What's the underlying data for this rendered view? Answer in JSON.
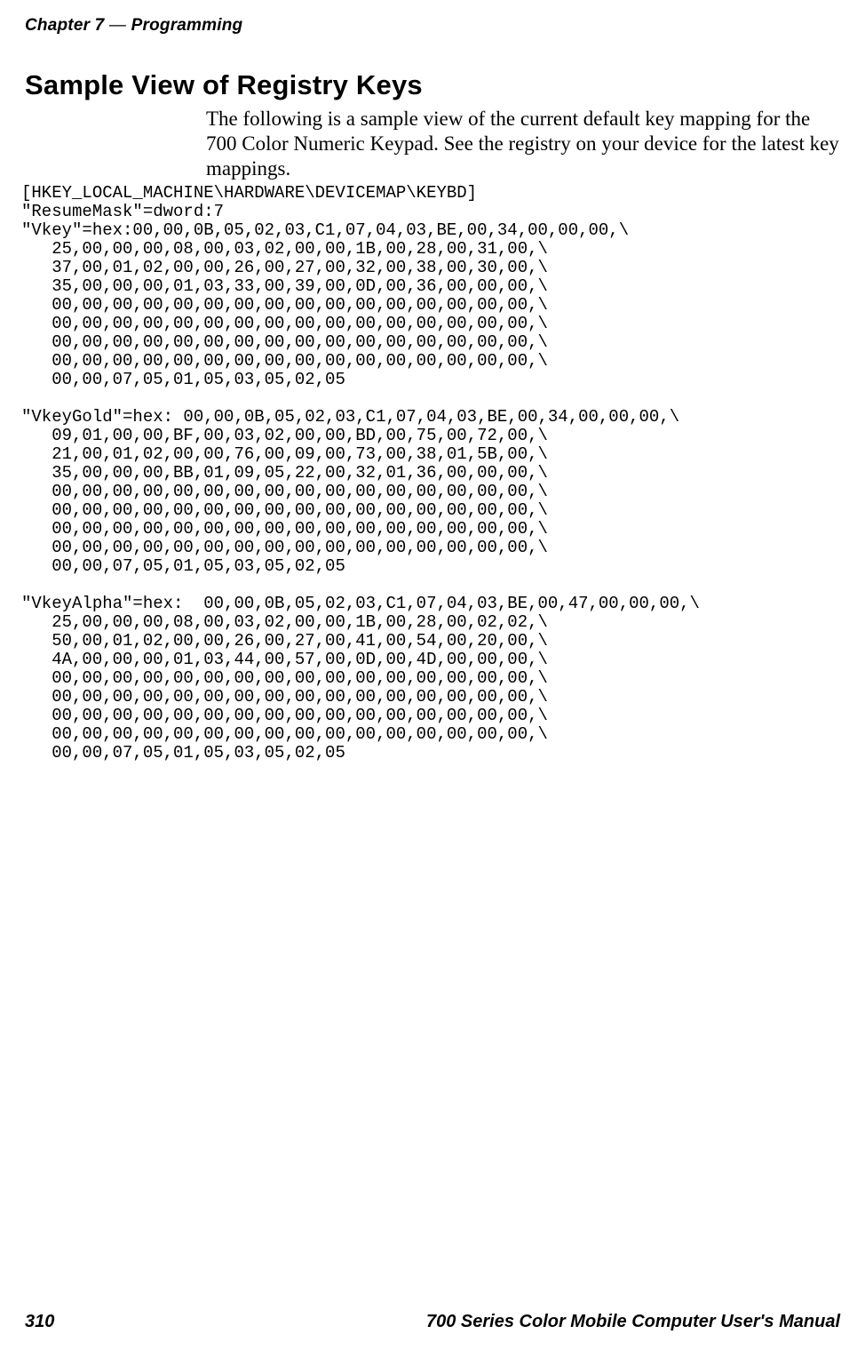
{
  "header": {
    "chapter_label": "Chapter 7",
    "dash": " — ",
    "chapter_topic": "Programming"
  },
  "heading": {
    "text": "Sample View of Registry Keys"
  },
  "intro": {
    "text": "The following is a sample view of the current default key mapping for the 700 Color Numeric Keypad. See the registry on your device for the latest key mappings."
  },
  "code": {
    "text": "[HKEY_LOCAL_MACHINE\\HARDWARE\\DEVICEMAP\\KEYBD]\n\"ResumeMask\"=dword:7\n\"Vkey\"=hex:00,00,0B,05,02,03,C1,07,04,03,BE,00,34,00,00,00,\\\n   25,00,00,00,08,00,03,02,00,00,1B,00,28,00,31,00,\\\n   37,00,01,02,00,00,26,00,27,00,32,00,38,00,30,00,\\\n   35,00,00,00,01,03,33,00,39,00,0D,00,36,00,00,00,\\\n   00,00,00,00,00,00,00,00,00,00,00,00,00,00,00,00,\\\n   00,00,00,00,00,00,00,00,00,00,00,00,00,00,00,00,\\\n   00,00,00,00,00,00,00,00,00,00,00,00,00,00,00,00,\\\n   00,00,00,00,00,00,00,00,00,00,00,00,00,00,00,00,\\\n   00,00,07,05,01,05,03,05,02,05\n\n\"VkeyGold\"=hex: 00,00,0B,05,02,03,C1,07,04,03,BE,00,34,00,00,00,\\\n   09,01,00,00,BF,00,03,02,00,00,BD,00,75,00,72,00,\\\n   21,00,01,02,00,00,76,00,09,00,73,00,38,01,5B,00,\\\n   35,00,00,00,BB,01,09,05,22,00,32,01,36,00,00,00,\\\n   00,00,00,00,00,00,00,00,00,00,00,00,00,00,00,00,\\\n   00,00,00,00,00,00,00,00,00,00,00,00,00,00,00,00,\\\n   00,00,00,00,00,00,00,00,00,00,00,00,00,00,00,00,\\\n   00,00,00,00,00,00,00,00,00,00,00,00,00,00,00,00,\\\n   00,00,07,05,01,05,03,05,02,05\n\n\"VkeyAlpha\"=hex:  00,00,0B,05,02,03,C1,07,04,03,BE,00,47,00,00,00,\\\n   25,00,00,00,08,00,03,02,00,00,1B,00,28,00,02,02,\\\n   50,00,01,02,00,00,26,00,27,00,41,00,54,00,20,00,\\\n   4A,00,00,00,01,03,44,00,57,00,0D,00,4D,00,00,00,\\\n   00,00,00,00,00,00,00,00,00,00,00,00,00,00,00,00,\\\n   00,00,00,00,00,00,00,00,00,00,00,00,00,00,00,00,\\\n   00,00,00,00,00,00,00,00,00,00,00,00,00,00,00,00,\\\n   00,00,00,00,00,00,00,00,00,00,00,00,00,00,00,00,\\\n   00,00,07,05,01,05,03,05,02,05"
  },
  "footer": {
    "page_number": "310",
    "manual_title": "700 Series Color Mobile Computer User's Manual"
  }
}
